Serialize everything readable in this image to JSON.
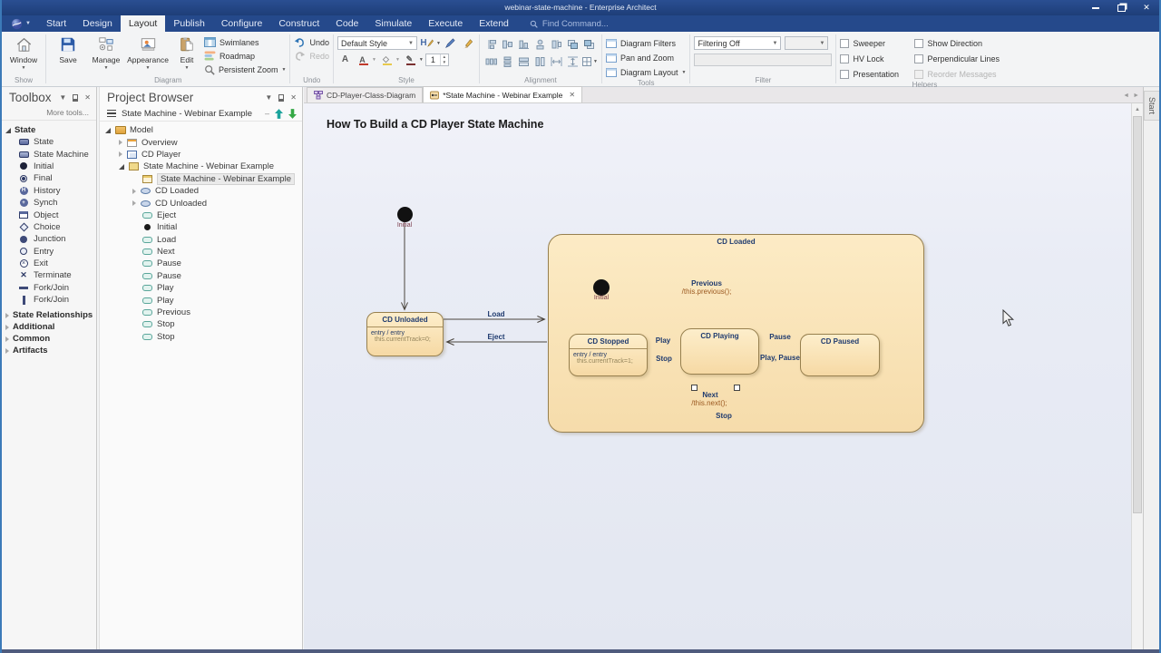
{
  "titlebar": {
    "title": "webinar-state-machine - Enterprise Architect"
  },
  "menu": {
    "tabs": [
      "Start",
      "Design",
      "Layout",
      "Publish",
      "Configure",
      "Construct",
      "Code",
      "Simulate",
      "Execute",
      "Extend"
    ],
    "find": "Find Command..."
  },
  "ribbon": {
    "show": {
      "window": "Window",
      "label": "Show"
    },
    "diagram": {
      "save": "Save",
      "manage": "Manage",
      "appearance": "Appearance",
      "edit": "Edit",
      "swimlanes": "Swimlanes",
      "roadmap": "Roadmap",
      "persistent_zoom": "Persistent Zoom",
      "label": "Diagram"
    },
    "undo": {
      "undo": "Undo",
      "redo": "Redo",
      "label": "Undo"
    },
    "style": {
      "default_style": "Default Style",
      "stroke_width": "1",
      "label": "Style"
    },
    "alignment": {
      "label": "Alignment"
    },
    "tools": {
      "filters": "Diagram Filters",
      "pan": "Pan and Zoom",
      "layout": "Diagram Layout",
      "label": "Tools"
    },
    "filter": {
      "mode": "Filtering Off",
      "label": "Filter"
    },
    "helpers": {
      "items": [
        "Sweeper",
        "HV Lock",
        "Presentation",
        "Show Direction",
        "Perpendicular Lines",
        "Reorder Messages"
      ],
      "label": "Helpers"
    }
  },
  "toolbox": {
    "title": "Toolbox",
    "more": "More tools...",
    "section": "State",
    "items": [
      {
        "label": "State"
      },
      {
        "label": "State Machine"
      },
      {
        "label": "Initial"
      },
      {
        "label": "Final"
      },
      {
        "label": "History"
      },
      {
        "label": "Synch"
      },
      {
        "label": "Object"
      },
      {
        "label": "Choice"
      },
      {
        "label": "Junction"
      },
      {
        "label": "Entry"
      },
      {
        "label": "Exit"
      },
      {
        "label": "Terminate"
      },
      {
        "label": "Fork/Join"
      },
      {
        "label": "Fork/Join"
      }
    ],
    "sections": [
      "State Relationships",
      "Additional",
      "Common",
      "Artifacts"
    ]
  },
  "project_browser": {
    "title": "Project Browser",
    "toolbar_label": "State Machine - Webinar Example",
    "rows": [
      {
        "label": "Model"
      },
      {
        "label": "Overview"
      },
      {
        "label": "CD Player"
      },
      {
        "label": "State Machine - Webinar Example"
      },
      {
        "label": "State Machine - Webinar Example"
      },
      {
        "label": "CD Loaded"
      },
      {
        "label": "CD Unloaded"
      },
      {
        "label": "Eject"
      },
      {
        "label": "Initial"
      },
      {
        "label": "Load"
      },
      {
        "label": "Next"
      },
      {
        "label": "Pause"
      },
      {
        "label": "Pause"
      },
      {
        "label": "Play"
      },
      {
        "label": "Play"
      },
      {
        "label": "Previous"
      },
      {
        "label": "Stop"
      },
      {
        "label": "Stop"
      }
    ]
  },
  "doc_tabs": {
    "tab1": "CD-Player-Class-Diagram",
    "tab2": "*State Machine - Webinar Example"
  },
  "side_tab": "Start",
  "diagram": {
    "title": "How To Build a CD Player State Machine",
    "states": {
      "cd_unloaded": {
        "name": "CD Unloaded",
        "entry_label": "entry / entry",
        "entry_code": "this.currentTrack=0;"
      },
      "cd_loaded": {
        "name": "CD Loaded"
      },
      "cd_stopped": {
        "name": "CD Stopped",
        "entry_label": "entry / entry",
        "entry_code": "this.currentTrack=1;"
      },
      "cd_playing": {
        "name": "CD Playing"
      },
      "cd_paused": {
        "name": "CD Paused"
      }
    },
    "initial_outer": "Initial",
    "initial_inner": "Initial",
    "transitions": {
      "load": "Load",
      "eject": "Eject",
      "play": "Play",
      "stop": "Stop",
      "pause": "Pause",
      "play_pause": "Play, Pause",
      "previous": "Previous",
      "previous_effect": "/this.previous();",
      "next": "Next",
      "next_effect": "/this.next();",
      "stop_long": "Stop"
    }
  }
}
